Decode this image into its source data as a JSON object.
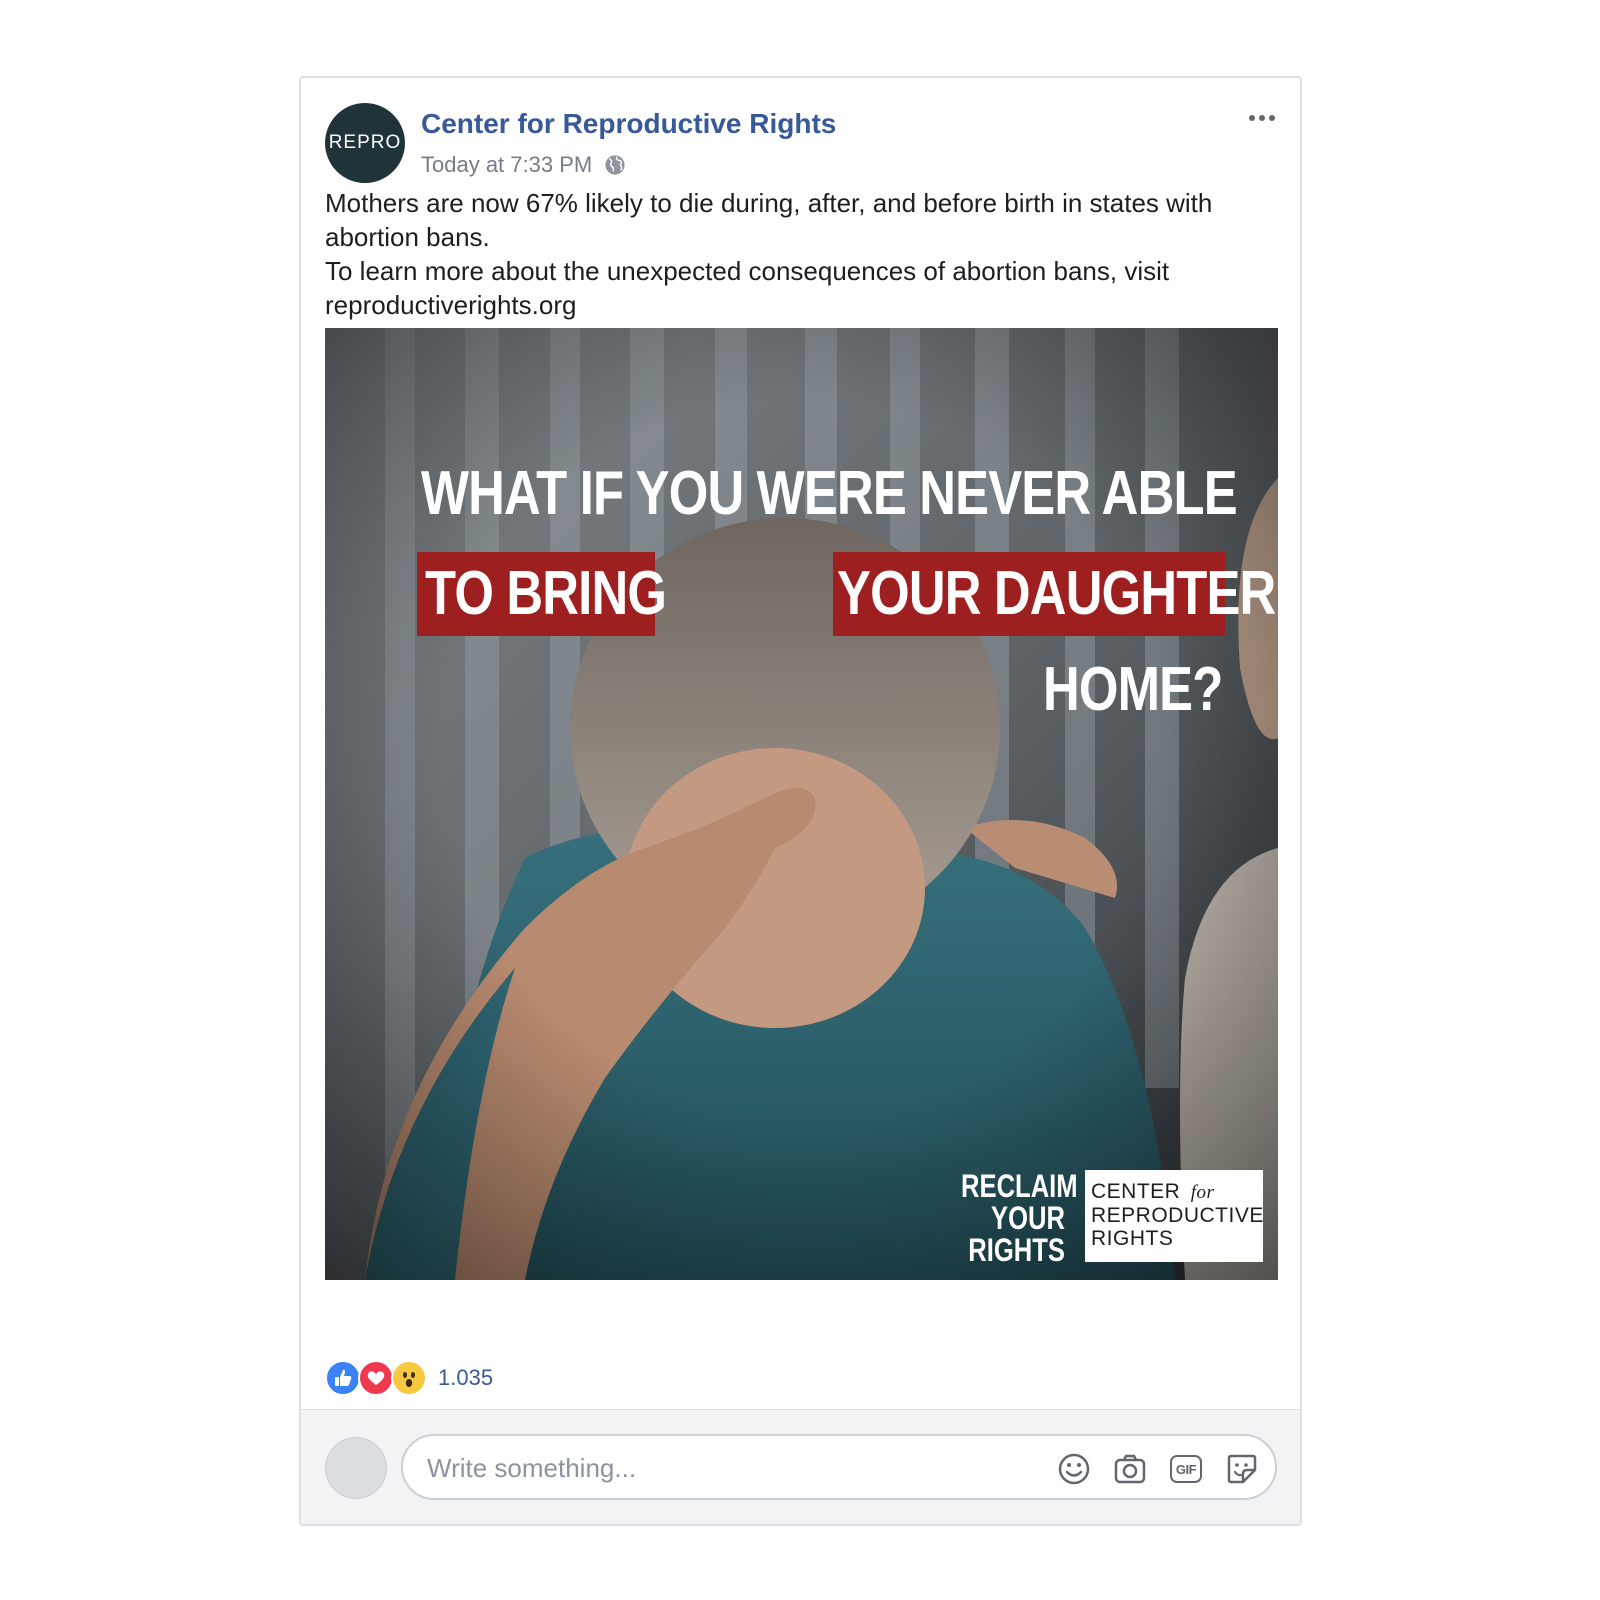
{
  "post": {
    "page_name": "Center for Reproductive Rights",
    "avatar_text": "REPRO",
    "timestamp": "Today at 7:33 PM",
    "privacy_icon": "globe-icon",
    "more_icon": "more-options-icon",
    "text_lines": [
      "Mothers are now 67% likely to die during, after, and before birth in states with abortion bans.",
      "To learn more about the unexpected consequences of abortion bans, visit reproductiverights.org"
    ]
  },
  "image": {
    "headline_line1": "WHAT IF YOU WERE NEVER ABLE",
    "headline_red_left": "TO BRING",
    "headline_red_right": "YOUR DAUGHTER",
    "headline_line3": "HOME?",
    "reclaim_1": "RECLAIM",
    "reclaim_2": "YOUR",
    "reclaim_3": "RIGHTS",
    "logo_line1": "CENTER",
    "logo_for": "for",
    "logo_line2": "REPRODUCTIVE",
    "logo_line3": "RIGHTS",
    "colors": {
      "banner_red": "#9e1f1f",
      "sweater": "#2f6673"
    }
  },
  "reactions": {
    "icons": [
      "like-icon",
      "love-icon",
      "wow-icon"
    ],
    "count": "1.035"
  },
  "comment": {
    "placeholder": "Write something...",
    "tools": [
      "emoji-icon",
      "camera-icon",
      "gif-icon",
      "sticker-icon"
    ],
    "gif_label": "GIF"
  },
  "colors": {
    "link": "#385898",
    "meta": "#757d88"
  }
}
